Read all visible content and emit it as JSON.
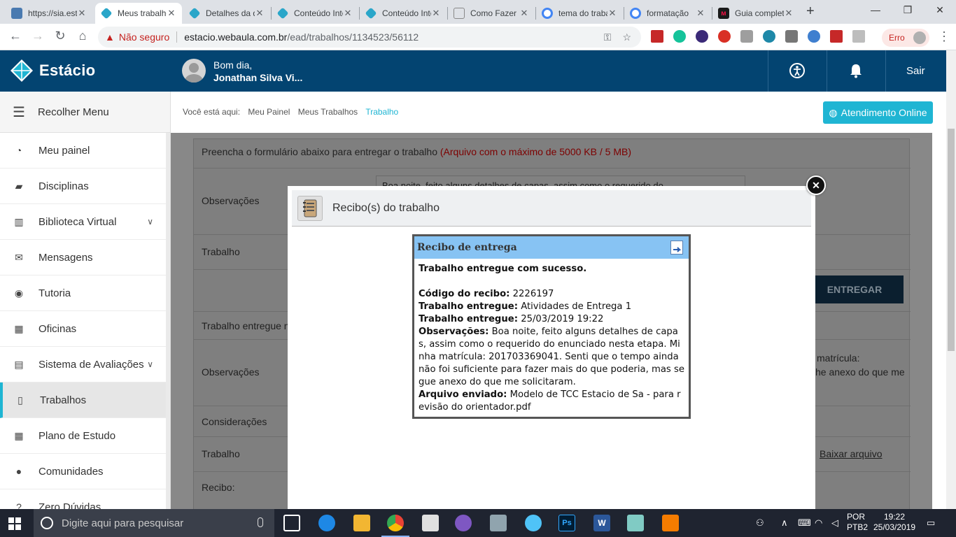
{
  "browser": {
    "tabs": [
      {
        "title": "https://sia.estacio.br",
        "favicon_color": "#4a7ab0",
        "active": false
      },
      {
        "title": "Meus trabalhos",
        "favicon_color": "#2aa6c9",
        "active": true
      },
      {
        "title": "Detalhes da disciplina",
        "favicon_color": "#2aa6c9",
        "active": false
      },
      {
        "title": "Conteúdo Interativo",
        "favicon_color": "#2aa6c9",
        "active": false
      },
      {
        "title": "Conteúdo Interativo",
        "favicon_color": "#2aa6c9",
        "active": false
      },
      {
        "title": "Como Fazer",
        "favicon_color": "#3a3a3a",
        "active": false
      },
      {
        "title": "tema do trabalho",
        "favicon_color": "#4285f4",
        "active": false
      },
      {
        "title": "formatação",
        "favicon_color": "#4285f4",
        "active": false
      },
      {
        "title": "Guia completo",
        "favicon_color": "#1a1a1a",
        "active": false
      }
    ],
    "security_label": "Não seguro",
    "url_host": "estacio.webaula.com.br",
    "url_path": "/ead/trabalhos/1134523/56112",
    "error_label": "Erro"
  },
  "header": {
    "brand": "Estácio",
    "greeting": "Bom dia,",
    "user_name": "Jonathan Silva Vi...",
    "logout": "Sair"
  },
  "sidebar": {
    "collapse_label": "Recolher Menu",
    "items": [
      {
        "label": "Meu painel",
        "icon": "dashboard-icon"
      },
      {
        "label": "Disciplinas",
        "icon": "book-icon"
      },
      {
        "label": "Biblioteca Virtual",
        "icon": "library-icon",
        "expandable": true
      },
      {
        "label": "Mensagens",
        "icon": "envelope-icon"
      },
      {
        "label": "Tutoria",
        "icon": "user-icon"
      },
      {
        "label": "Oficinas",
        "icon": "table-icon"
      },
      {
        "label": "Sistema de Avaliações",
        "icon": "file-icon",
        "expandable": true
      },
      {
        "label": "Trabalhos",
        "icon": "document-icon",
        "active": true
      },
      {
        "label": "Plano de Estudo",
        "icon": "calendar-icon"
      },
      {
        "label": "Comunidades",
        "icon": "chat-icon"
      },
      {
        "label": "Zero Dúvidas",
        "icon": "question-icon"
      }
    ]
  },
  "breadcrumb": {
    "prefix": "Você está aqui:",
    "items": [
      "Meu Painel",
      "Meus Trabalhos",
      "Trabalho"
    ]
  },
  "support_button": "Atendimento Online",
  "form": {
    "instructions": "Preencha o formulário abaixo para entregar o trabalho",
    "limit_note": "(Arquivo com o máximo de 5000 KB / 5 MB)",
    "observacoes_label": "Observações",
    "observacoes_value": "Boa noite, feito alguns detalhes de capas, assim como o requerido do",
    "trabalho_label": "Trabalho",
    "submit_label": "ENTREGAR",
    "delivered_label": "Trabalho entregue n",
    "delivered_obs_label": "Observações",
    "delivered_obs_tail_1": "matrícula:",
    "delivered_obs_tail_2": "he anexo do que me",
    "consideracoes_label": "Considerações",
    "trabalho2_label": "Trabalho",
    "download_link": "Baixar arquivo",
    "recibo_label": "Recibo:"
  },
  "modal": {
    "title": "Recibo(s) do trabalho",
    "receipt": {
      "heading": "Recibo de entrega",
      "success": "Trabalho entregue com sucesso.",
      "code_label": "Código do recibo:",
      "code_value": "2226197",
      "work_label": "Trabalho entregue:",
      "work_value": "Atividades de Entrega 1",
      "date_label": "Trabalho entregue:",
      "date_value": "25/03/2019 19:22",
      "obs_label": "Observações:",
      "obs_value": "Boa noite, feito alguns detalhes de capas, assim como o requerido do enunciado nesta etapa. Minha matrícula: 201703369041. Senti que o tempo ainda não foi suficiente para fazer mais do que poderia, mas segue anexo do que me solicitaram.",
      "file_label": "Arquivo enviado:",
      "file_value": "Modelo de TCC Estacio de Sa - para revisão do orientador.pdf"
    }
  },
  "taskbar": {
    "search_placeholder": "Digite aqui para pesquisar",
    "lang_1": "POR",
    "lang_2": "PTB2",
    "time": "19:22",
    "date": "25/03/2019"
  }
}
